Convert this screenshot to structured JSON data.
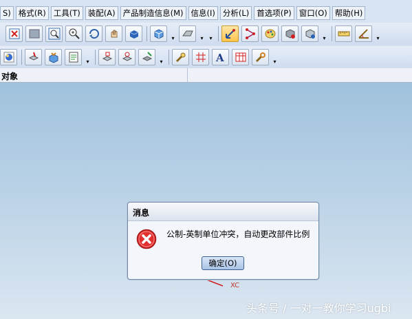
{
  "menu": [
    "S)",
    "格式(R)",
    "工具(T)",
    "装配(A)",
    "产品制造信息(M)",
    "信息(I)",
    "分析(L)",
    "首选项(P)",
    "窗口(O)",
    "帮助(H)"
  ],
  "navigator": {
    "title": "对象"
  },
  "dialog": {
    "title": "消息",
    "message": "公制-英制单位冲突，自动更改部件比例",
    "ok_label": "确定(O)"
  },
  "axis_label": "XC",
  "watermark": "头条号 / 一对一教你学习ugbi",
  "colors": {
    "error": "#e03030",
    "active": "#ffc44d",
    "canvas_top": "#a0c2dd"
  },
  "toolbar_icons_row1": [
    "fit-icon",
    "wireframe-icon",
    "zoom-window-icon",
    "zoom-icon",
    "rotate-icon",
    "pan-icon",
    "shaded-icon",
    "view-cube-icon",
    "render-style-icon",
    "point-select-icon",
    "snap-icon",
    "palette-icon",
    "hide-icon",
    "show-icon",
    "measure-icon",
    "angle-icon"
  ],
  "toolbar_icons_row2": [
    "sphere-icon",
    "feature-icon",
    "shape-icon",
    "properties-icon",
    "layer-icon",
    "transform-icon",
    "edit-icon",
    "tools-icon",
    "grid-icon",
    "text-icon",
    "table-icon",
    "wrench-icon"
  ]
}
